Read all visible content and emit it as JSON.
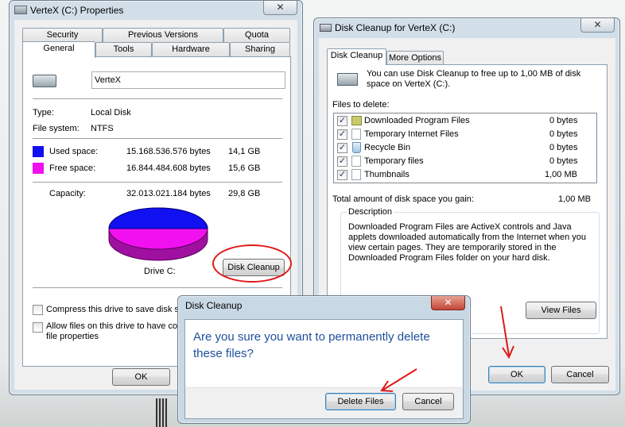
{
  "props": {
    "title": "VerteX (C:) Properties",
    "close": "✕",
    "tabs_back": [
      "Security",
      "Previous Versions",
      "Quota"
    ],
    "tabs_front": [
      "General",
      "Tools",
      "Hardware",
      "Sharing"
    ],
    "drive_name": "VerteX",
    "type_label": "Type:",
    "type_value": "Local Disk",
    "fs_label": "File system:",
    "fs_value": "NTFS",
    "used_label": "Used space:",
    "used_bytes": "15.168.536.576 bytes",
    "used_gb": "14,1 GB",
    "free_label": "Free space:",
    "free_bytes": "16.844.484.608 bytes",
    "free_gb": "15,6 GB",
    "cap_label": "Capacity:",
    "cap_bytes": "32.013.021.184 bytes",
    "cap_gb": "29,8 GB",
    "drive_label": "Drive C:",
    "disk_cleanup_btn": "Disk Cleanup",
    "compress_label": "Compress this drive to save disk spa",
    "index_label_1": "Allow files on this drive to have cont",
    "index_label_2": "file properties",
    "ok": "OK",
    "used_color": "#1010f0",
    "free_color": "#f010f0"
  },
  "cleanup": {
    "title": "Disk Cleanup for VerteX (C:)",
    "close": "✕",
    "tabs": [
      "Disk Cleanup",
      "More Options"
    ],
    "intro": "You can use Disk Cleanup to free up to 1,00 MB of disk space on VerteX (C:).",
    "files_to_delete": "Files to delete:",
    "files": [
      {
        "name": "Downloaded Program Files",
        "size": "0 bytes",
        "icon": "folder-icon"
      },
      {
        "name": "Temporary Internet Files",
        "size": "0 bytes",
        "icon": "file-icon"
      },
      {
        "name": "Recycle Bin",
        "size": "0 bytes",
        "icon": "recycle-bin-icon"
      },
      {
        "name": "Temporary files",
        "size": "0 bytes",
        "icon": "file-icon"
      },
      {
        "name": "Thumbnails",
        "size": "1,00 MB",
        "icon": "file-icon"
      }
    ],
    "check": "✓",
    "total_label": "Total amount of disk space you gain:",
    "total_value": "1,00 MB",
    "desc_title": "Description",
    "desc_text": "Downloaded Program Files are ActiveX controls and Java applets downloaded automatically from the Internet when you view certain pages. They are temporarily stored in the Downloaded Program Files folder on your hard disk.",
    "view_files": "View Files",
    "ok": "OK",
    "cancel": "Cancel"
  },
  "confirm": {
    "title": "Disk Cleanup",
    "close": "✕",
    "message": "Are you sure you want to permanently delete these files?",
    "delete_btn": "Delete Files",
    "cancel_btn": "Cancel"
  }
}
